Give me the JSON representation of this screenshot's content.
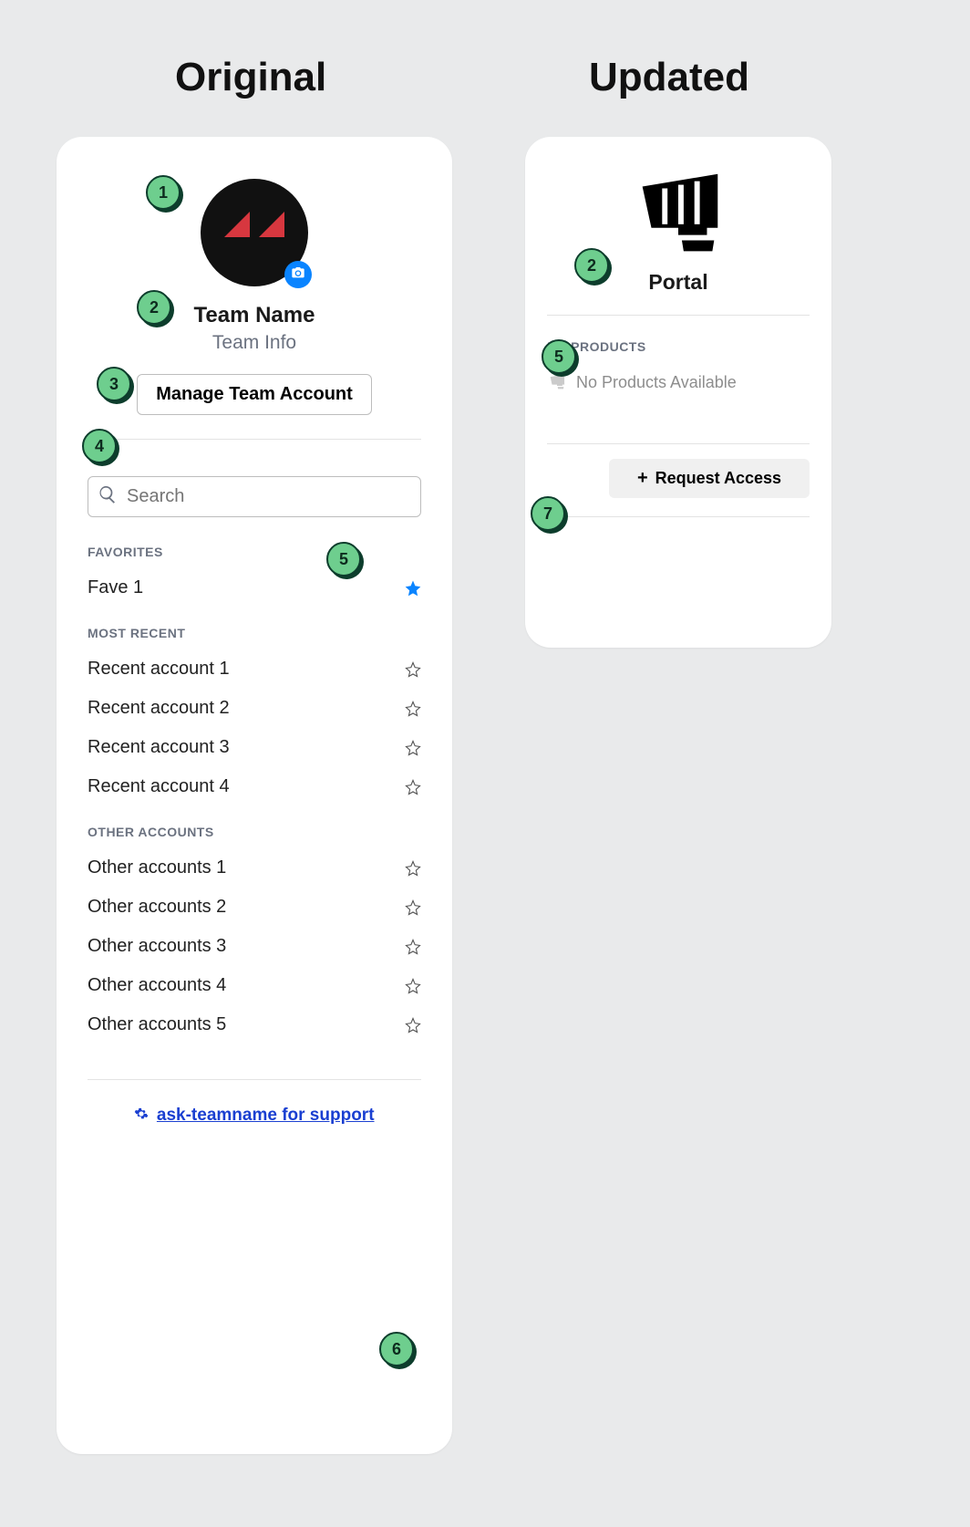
{
  "headings": {
    "original": "Original",
    "updated": "Updated"
  },
  "original": {
    "team_name": "Team Name",
    "team_info": "Team Info",
    "manage_button": "Manage Team Account",
    "search_placeholder": "Search",
    "sections": {
      "favorites_label": "FAVORITES",
      "most_recent_label": "MOST RECENT",
      "other_accounts_label": "OTHER ACCOUNTS"
    },
    "favorites": [
      {
        "label": "Fave 1",
        "starred": true
      }
    ],
    "recent": [
      {
        "label": "Recent account 1"
      },
      {
        "label": "Recent account 2"
      },
      {
        "label": "Recent account 3"
      },
      {
        "label": "Recent account 4"
      }
    ],
    "other": [
      {
        "label": "Other accounts 1"
      },
      {
        "label": "Other accounts 2"
      },
      {
        "label": "Other accounts 3"
      },
      {
        "label": "Other accounts 4"
      },
      {
        "label": "Other accounts 5"
      }
    ],
    "support_link": "ask-teamname for support"
  },
  "updated": {
    "title": "Portal",
    "my_products_label": "MY PRODUCTS",
    "no_products_text": "No Products Available",
    "request_access_label": "Request Access"
  },
  "bullets": {
    "b1": "1",
    "b2o": "2",
    "b3": "3",
    "b4": "4",
    "b5o": "5",
    "b6": "6",
    "b2u": "2",
    "b5u": "5",
    "b7": "7"
  }
}
